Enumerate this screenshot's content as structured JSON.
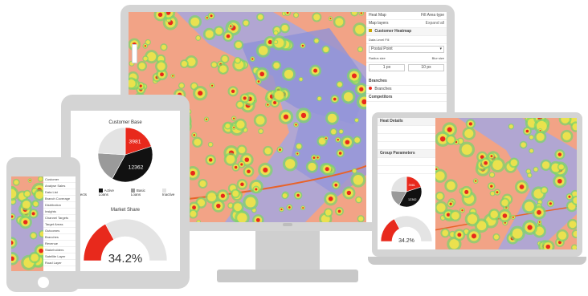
{
  "desktop": {
    "panel": {
      "tab_left": "Heat Map",
      "tab_right": "Fill Area type",
      "section_map_layers": "Map layers",
      "expand_all": "Expand all",
      "layer_name": "Customer Heatmap",
      "data_label": "Data Level Fill",
      "select_value": "Postal Point",
      "radius_label": "Radius size",
      "blur_label": "Blur size",
      "radius_value": "1 px",
      "blur_value": "10 px",
      "branches_label": "Branches",
      "branches_item": "Branches",
      "competitors_label": "Competitors"
    }
  },
  "tablet": {
    "pie_chart_title": "Customer Base",
    "donut_title": "Market Share",
    "donut_value": "34.2%"
  },
  "laptop": {
    "panel_title": "Heat Details",
    "panel_section2": "Group Parameters",
    "donut_value": "34.2%"
  },
  "chart_data": [
    {
      "type": "pie",
      "title": "Customer Base",
      "categories": [
        "Prospects",
        "Active Loans",
        "Basic Loans",
        "Inactive"
      ],
      "values": [
        20,
        38,
        18,
        24
      ],
      "data_labels": [
        "3981",
        "12362",
        "",
        ""
      ],
      "colors": [
        "#e8291c",
        "#111111",
        "#9a9a9a",
        "#e3e3e3"
      ]
    },
    {
      "type": "pie",
      "title": "Market Share",
      "values": [
        34.2,
        65.8
      ],
      "center_label": "34.2%",
      "colors": [
        "#e8291c",
        "#e4e4e4"
      ]
    }
  ],
  "phone": {
    "menu_items": [
      "Customer",
      "Analyse Sales",
      "Data List",
      "Branch Coverage",
      "Distribution",
      "Insights",
      "Channel Targets",
      "Target Areas",
      "Outcomes",
      "Branches",
      "Revenue",
      "Stakeholders",
      "Satellite Layer",
      "Road Layer"
    ]
  }
}
